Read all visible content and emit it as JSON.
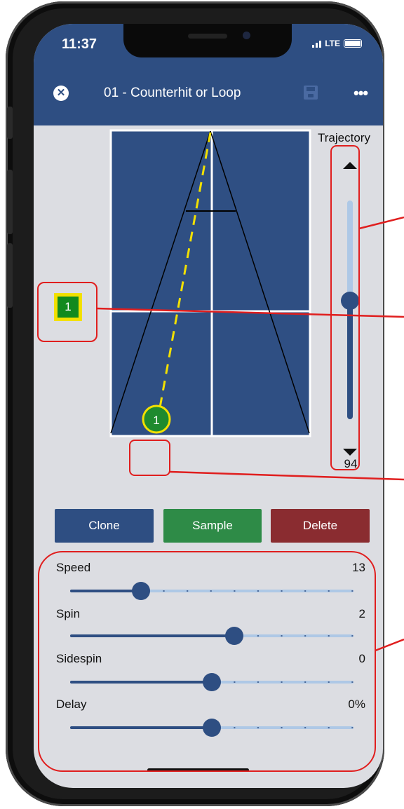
{
  "status": {
    "time": "11:37",
    "network": "LTE"
  },
  "header": {
    "title": "01 - Counterhit or Loop"
  },
  "table": {
    "marker_label": "1",
    "ball_label": "1"
  },
  "trajectory": {
    "label": "Trajectory",
    "value": "94",
    "level": 0.55
  },
  "buttons": {
    "clone": "Clone",
    "sample": "Sample",
    "delete": "Delete"
  },
  "params": [
    {
      "label": "Speed",
      "value": "13",
      "fraction": 0.25
    },
    {
      "label": "Spin",
      "value": "2",
      "fraction": 0.58
    },
    {
      "label": "Sidespin",
      "value": "0",
      "fraction": 0.5
    },
    {
      "label": "Delay",
      "value": "0%",
      "fraction": 0.5
    }
  ],
  "colors": {
    "header": "#2e4e82",
    "table": "#2f4f83",
    "clone": "#2e4e82",
    "sample": "#2e8b47",
    "delete": "#8a2c30",
    "annotation": "#e01e1e",
    "trajectory_line": "#f2e000"
  },
  "icons": [
    "close-icon",
    "save-icon",
    "more-icon",
    "arrow-up-icon",
    "arrow-down-icon"
  ]
}
